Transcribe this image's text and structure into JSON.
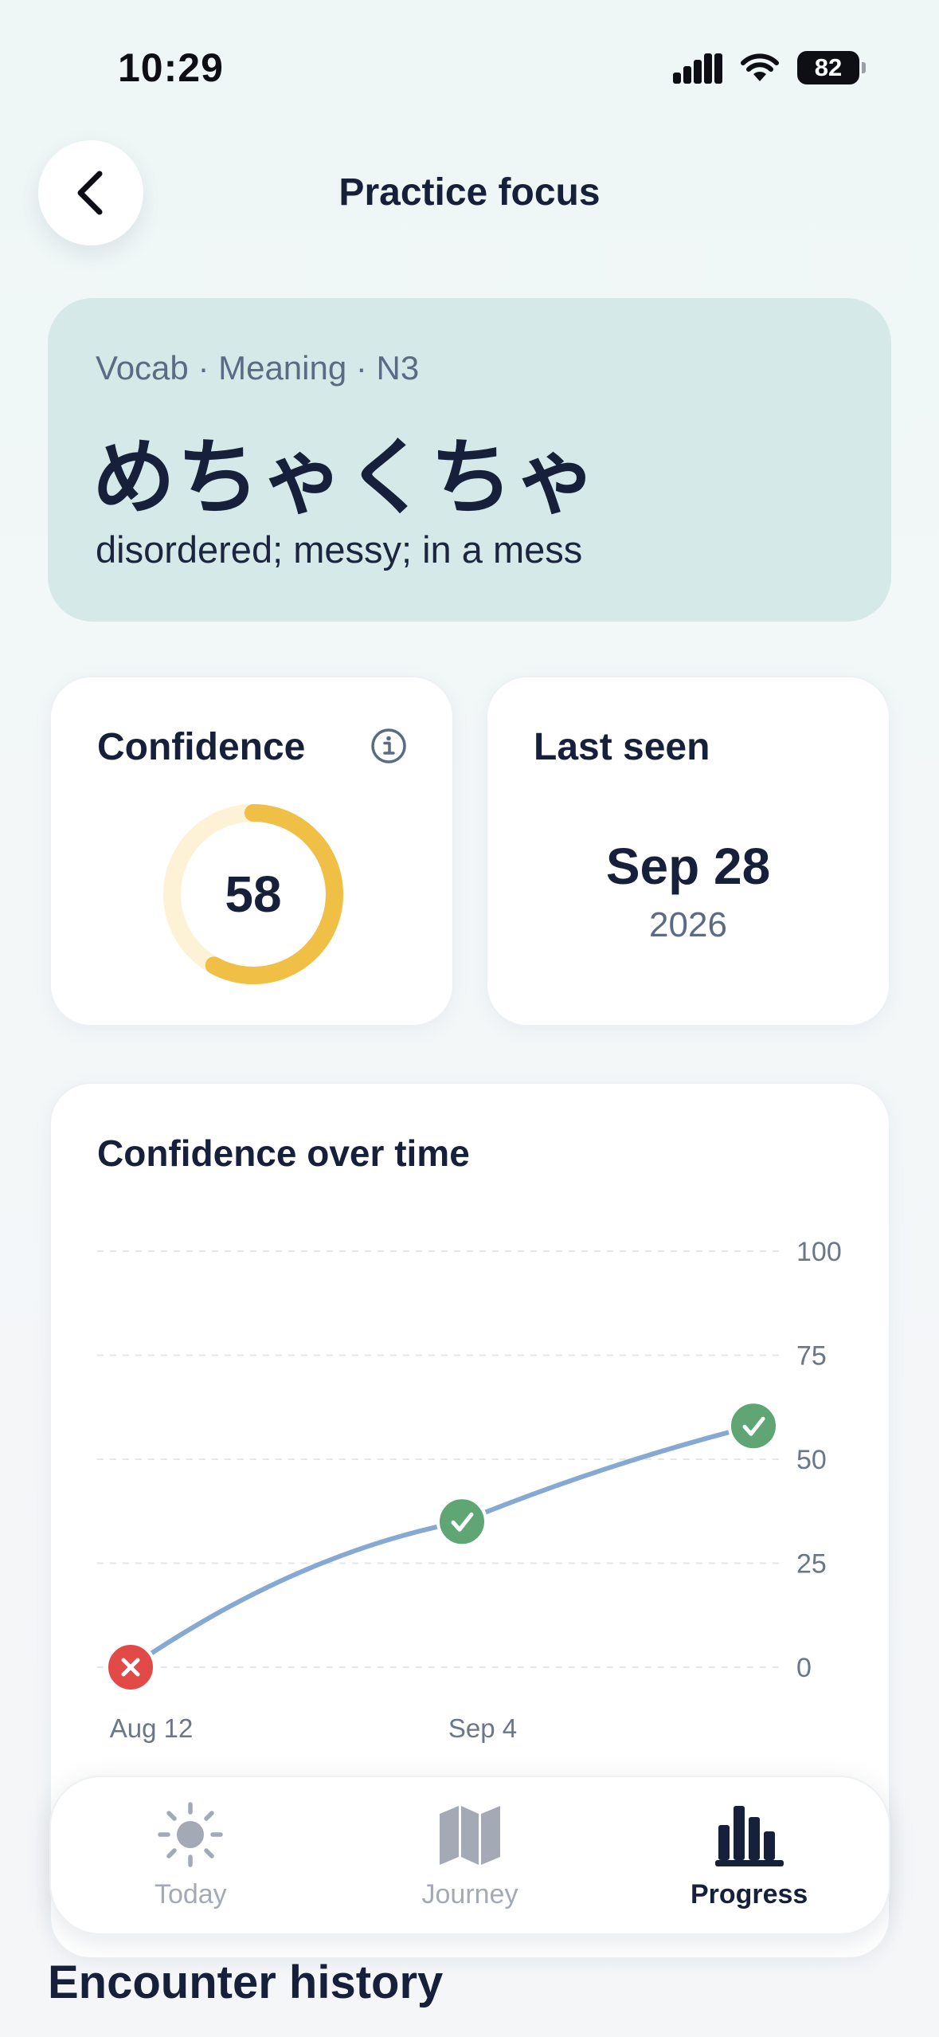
{
  "status_bar": {
    "time": "10:29",
    "battery": "82",
    "icons": [
      "cellular-signal-icon",
      "wifi-icon",
      "battery-icon"
    ]
  },
  "header": {
    "title": "Practice focus",
    "back_icon": "chevron-left-icon"
  },
  "item": {
    "meta": "Vocab · Meaning · N3",
    "word": "めちゃくちゃ",
    "meaning": "disordered; messy; in a mess"
  },
  "confidence": {
    "label": "Confidence",
    "value": "58",
    "fraction": 0.58,
    "info_icon": "info-circle-icon"
  },
  "last_seen": {
    "label": "Last seen",
    "date": "Sep 28",
    "year": "2026"
  },
  "chart_data": {
    "type": "line",
    "title": "Confidence over time",
    "y_ticks": [
      "100",
      "75",
      "50",
      "25",
      "0"
    ],
    "x_tick_labels": [
      "Aug 12",
      "Sep 4"
    ],
    "ylim": [
      0,
      100
    ],
    "grid": true,
    "series": [
      {
        "color": "#86a9d3",
        "points": [
          {
            "x": "Aug 12",
            "y": 0,
            "result": "incorrect"
          },
          {
            "x": "Sep 4",
            "y": 35,
            "result": "correct"
          },
          {
            "x": "",
            "y": 58,
            "result": "correct"
          }
        ]
      }
    ],
    "colors": {
      "correct": "#5fa674",
      "incorrect": "#e14a46"
    }
  },
  "tabs": [
    {
      "label": "Today",
      "icon": "sun-icon",
      "active": false
    },
    {
      "label": "Journey",
      "icon": "map-icon",
      "active": false
    },
    {
      "label": "Progress",
      "icon": "bar-chart-icon",
      "active": true
    }
  ],
  "sections": {
    "encounter_history": "Encounter history"
  },
  "colors": {
    "hero_bg": "#d5eae8",
    "ring_fill": "#f0bf45",
    "ring_track": "#fdf1d6",
    "text_dark": "#17203a",
    "text_muted": "#5c6b84"
  }
}
